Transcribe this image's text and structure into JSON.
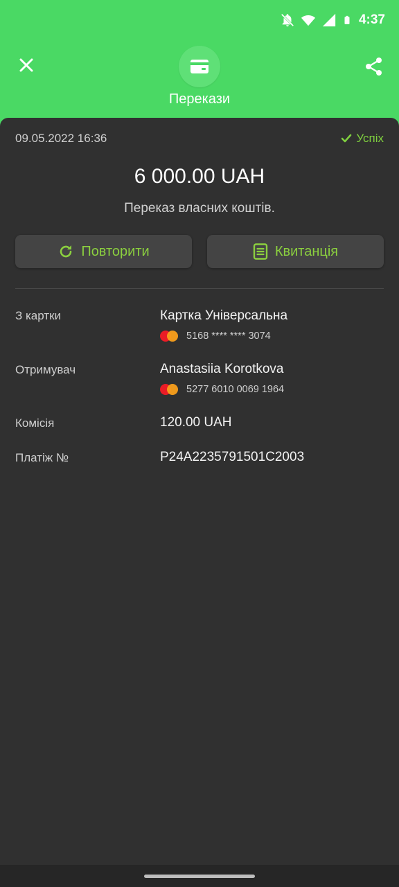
{
  "status_bar": {
    "time": "4:37"
  },
  "header": {
    "category_title": "Перекази"
  },
  "transaction": {
    "datetime": "09.05.2022 16:36",
    "status": "Успіх",
    "amount": "6 000.00 UAH",
    "description": "Переказ власних коштів."
  },
  "actions": {
    "repeat_label": "Повторити",
    "receipt_label": "Квитанція"
  },
  "details": {
    "from": {
      "label": "З картки",
      "value": "Картка Універсальна",
      "card": "5168 **** **** 3074"
    },
    "recipient": {
      "label": "Отримувач",
      "value": "Anastasiia Korotkova",
      "card": "5277 6010 0069 1964"
    },
    "fee": {
      "label": "Комісія",
      "value": "120.00 UAH"
    },
    "payment": {
      "label": "Платіж №",
      "value": "P24A2235791501C2003"
    }
  },
  "colors": {
    "header_green": "#4ad964",
    "accent_green": "#8bcf3f",
    "sheet_bg": "#303030"
  }
}
